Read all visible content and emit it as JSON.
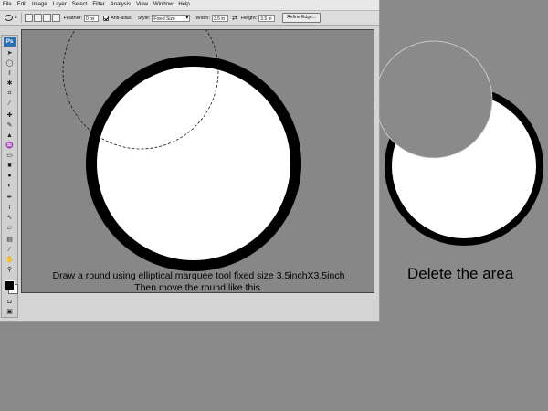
{
  "menubar": {
    "items": [
      "File",
      "Edit",
      "Image",
      "Layer",
      "Select",
      "Filter",
      "Analysis",
      "View",
      "Window",
      "Help"
    ]
  },
  "options_bar": {
    "feather_label": "Feather:",
    "feather_value": "0 px",
    "antialias_label": "Anti-alias",
    "style_label": "Style:",
    "style_value": "Fixed Size",
    "width_label": "Width:",
    "width_value": "3.5 in",
    "height_label": "Height:",
    "height_value": "3.5 in",
    "refine_edge_label": "Refine Edge..."
  },
  "toolbox": {
    "logo": "Ps",
    "tools": [
      "move-icon",
      "marquee-icon",
      "lasso-icon",
      "magic-wand-icon",
      "crop-icon",
      "eyedropper-icon",
      "healing-icon",
      "brush-icon",
      "clone-stamp-icon",
      "history-brush-icon",
      "eraser-icon",
      "gradient-icon",
      "blur-icon",
      "dodge-icon",
      "pen-icon",
      "type-icon",
      "path-select-icon",
      "shape-icon",
      "notes-icon",
      "eyedropper2-icon",
      "hand-icon",
      "zoom-icon"
    ]
  },
  "canvas": {
    "caption_line1": "Draw a round using elliptical marquee tool fixed size 3.5inchX3.5inch",
    "caption_line2": "Then move the round like this."
  },
  "side": {
    "delete_text": "Delete the area"
  }
}
